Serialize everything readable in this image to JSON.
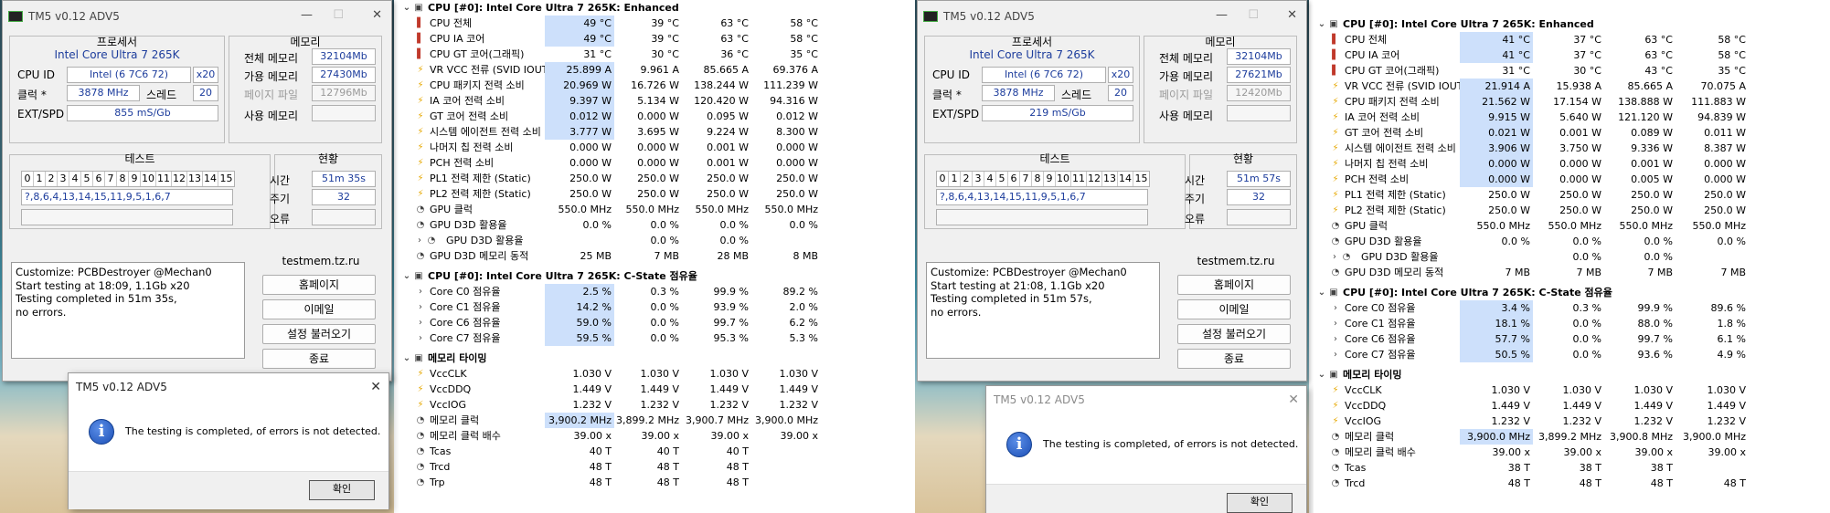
{
  "left": {
    "tm5": {
      "title": "TM5 v0.12 ADV5",
      "proc_label": "프로세서",
      "proc_name": "Intel Core Ultra 7 265K",
      "cpuid_label": "CPU ID",
      "cpuid_value": "Intel  (6 7C6 72)",
      "cpuid_x": "x20",
      "clock_label": "클럭 *",
      "clock_value": "3878 MHz",
      "thread_label": "스레드",
      "thread_value": "20",
      "extspd_label": "EXT/SPD",
      "extspd_value": "855 mS/Gb",
      "mem_label": "메모리",
      "total_mem_label": "전체 메모리",
      "total_mem_value": "32104Mb",
      "avail_mem_label": "가용 메모리",
      "avail_mem_value": "27430Mb",
      "page_file_label": "페이지 파일",
      "page_file_value": "12796Mb",
      "used_mem_label": "사용 메모리",
      "test_label": "테스트",
      "test_nums": [
        "0",
        "1",
        "2",
        "3",
        "4",
        "5",
        "6",
        "7",
        "8",
        "9",
        "10",
        "11",
        "12",
        "13",
        "14",
        "15"
      ],
      "test_seq": "?,8,6,4,13,14,15,11,9,5,1,6,7",
      "status_label": "현황",
      "time_label": "시간",
      "time_value": "51m 35s",
      "cycle_label": "주기",
      "cycle_value": "32",
      "error_label": "오류",
      "log": "Customize: PCBDestroyer @Mechan0\nStart testing at 18:09, 1.1Gb x20\nTesting completed in 51m 35s,\nno errors.",
      "site": "testmem.tz.ru",
      "btn_home": "홈페이지",
      "btn_email": "이메일",
      "btn_load": "설정 불러오기",
      "btn_exit": "종료"
    },
    "dialog": {
      "title": "TM5 v0.12 ADV5",
      "message": "The testing is completed, of errors is not detected.",
      "ok": "확인"
    },
    "hw": {
      "sections": [
        {
          "title": "CPU [#0]: Intel Core Ultra 7 265K: Enhanced",
          "rows": [
            {
              "icon": "therm",
              "label": "CPU 전체",
              "v": [
                "49 °C",
                "39 °C",
                "63 °C",
                "58 °C"
              ],
              "hl": true
            },
            {
              "icon": "therm",
              "label": "CPU IA 코어",
              "v": [
                "49 °C",
                "39 °C",
                "63 °C",
                "58 °C"
              ],
              "hl": true
            },
            {
              "icon": "therm",
              "label": "CPU GT 코어(그래픽)",
              "v": [
                "31 °C",
                "30 °C",
                "36 °C",
                "35 °C"
              ]
            },
            {
              "icon": "bolt",
              "label": "VR VCC 전류 (SVID IOUT)",
              "v": [
                "25.899 A",
                "9.961 A",
                "85.665 A",
                "69.376 A"
              ],
              "hl": true
            },
            {
              "icon": "bolt",
              "label": "CPU 패키지 전력 소비",
              "v": [
                "20.969 W",
                "16.726 W",
                "138.244 W",
                "111.239 W"
              ],
              "hl": true
            },
            {
              "icon": "bolt",
              "label": "IA 코어 전력 소비",
              "v": [
                "9.397 W",
                "5.134 W",
                "120.420 W",
                "94.316 W"
              ],
              "hl": true
            },
            {
              "icon": "bolt",
              "label": "GT 코어 전력 소비",
              "v": [
                "0.012 W",
                "0.000 W",
                "0.095 W",
                "0.012 W"
              ],
              "hl": true
            },
            {
              "icon": "bolt",
              "label": "시스템 에이전트 전력 소비",
              "v": [
                "3.777 W",
                "3.695 W",
                "9.224 W",
                "8.300 W"
              ],
              "hl": true
            },
            {
              "icon": "bolt",
              "label": "나머지 칩 전력 소비",
              "v": [
                "0.000 W",
                "0.000 W",
                "0.001 W",
                "0.000 W"
              ]
            },
            {
              "icon": "bolt",
              "label": "PCH 전력 소비",
              "v": [
                "0.000 W",
                "0.000 W",
                "0.001 W",
                "0.000 W"
              ]
            },
            {
              "icon": "bolt",
              "label": "PL1 전력 제한 (Static)",
              "v": [
                "250.0 W",
                "250.0 W",
                "250.0 W",
                "250.0 W"
              ]
            },
            {
              "icon": "bolt",
              "label": "PL2 전력 제한 (Static)",
              "v": [
                "250.0 W",
                "250.0 W",
                "250.0 W",
                "250.0 W"
              ]
            },
            {
              "icon": "clock",
              "label": "GPU 클럭",
              "v": [
                "550.0 MHz",
                "550.0 MHz",
                "550.0 MHz",
                "550.0 MHz"
              ]
            },
            {
              "icon": "clock",
              "label": "GPU D3D 활용율",
              "v": [
                "0.0 %",
                "0.0 %",
                "0.0 %",
                "0.0 %"
              ]
            },
            {
              "icon": "chev",
              "label": "GPU D3D 활용율",
              "v": [
                "",
                "0.0 %",
                "0.0 %",
                ""
              ],
              "indent": true
            },
            {
              "icon": "clock",
              "label": "GPU D3D 메모리 동적",
              "v": [
                "25 MB",
                "7 MB",
                "28 MB",
                "8 MB"
              ]
            }
          ]
        },
        {
          "title": "CPU [#0]: Intel Core Ultra 7 265K: C-State 점유율",
          "rows": [
            {
              "icon": "chev",
              "label": "Core C0 점유율",
              "v": [
                "2.5 %",
                "0.3 %",
                "99.9 %",
                "89.2 %"
              ],
              "hl": true
            },
            {
              "icon": "chev",
              "label": "Core C1 점유율",
              "v": [
                "14.2 %",
                "0.0 %",
                "93.9 %",
                "2.0 %"
              ],
              "hl": true
            },
            {
              "icon": "chev",
              "label": "Core C6 점유율",
              "v": [
                "59.0 %",
                "0.0 %",
                "99.7 %",
                "6.2 %"
              ],
              "hl": true
            },
            {
              "icon": "chev",
              "label": "Core C7 점유율",
              "v": [
                "59.5 %",
                "0.0 %",
                "95.3 %",
                "5.3 %"
              ],
              "hl": true
            }
          ]
        },
        {
          "title": "메모리 타이밍",
          "rows": [
            {
              "icon": "bolt",
              "label": "VccCLK",
              "v": [
                "1.030 V",
                "1.030 V",
                "1.030 V",
                "1.030 V"
              ]
            },
            {
              "icon": "bolt",
              "label": "VccDDQ",
              "v": [
                "1.449 V",
                "1.449 V",
                "1.449 V",
                "1.449 V"
              ]
            },
            {
              "icon": "bolt",
              "label": "VccIOG",
              "v": [
                "1.232 V",
                "1.232 V",
                "1.232 V",
                "1.232 V"
              ]
            },
            {
              "icon": "clock",
              "label": "메모리 클럭",
              "v": [
                "3,900.2 MHz",
                "3,899.2 MHz",
                "3,900.7 MHz",
                "3,900.0 MHz"
              ],
              "hl": true
            },
            {
              "icon": "clock",
              "label": "메모리 클럭 배수",
              "v": [
                "39.00 x",
                "39.00 x",
                "39.00 x",
                "39.00 x"
              ]
            },
            {
              "icon": "clock",
              "label": "Tcas",
              "v": [
                "40 T",
                "40 T",
                "40 T",
                ""
              ]
            },
            {
              "icon": "clock",
              "label": "Trcd",
              "v": [
                "48 T",
                "48 T",
                "48 T",
                ""
              ]
            },
            {
              "icon": "clock",
              "label": "Trp",
              "v": [
                "48 T",
                "48 T",
                "48 T",
                ""
              ]
            }
          ]
        }
      ]
    }
  },
  "right": {
    "tm5": {
      "title": "TM5 v0.12 ADV5",
      "proc_label": "프로세서",
      "proc_name": "Intel Core Ultra 7 265K",
      "cpuid_label": "CPU ID",
      "cpuid_value": "Intel  (6 7C6 72)",
      "cpuid_x": "x20",
      "clock_label": "클럭 *",
      "clock_value": "3878 MHz",
      "thread_label": "스레드",
      "thread_value": "20",
      "extspd_label": "EXT/SPD",
      "extspd_value": "219 mS/Gb",
      "mem_label": "메모리",
      "total_mem_label": "전체 메모리",
      "total_mem_value": "32104Mb",
      "avail_mem_label": "가용 메모리",
      "avail_mem_value": "27621Mb",
      "page_file_label": "페이지 파일",
      "page_file_value": "12420Mb",
      "used_mem_label": "사용 메모리",
      "test_label": "테스트",
      "test_nums": [
        "0",
        "1",
        "2",
        "3",
        "4",
        "5",
        "6",
        "7",
        "8",
        "9",
        "10",
        "11",
        "12",
        "13",
        "14",
        "15"
      ],
      "test_seq": "?,8,6,4,13,14,15,11,9,5,1,6,7",
      "status_label": "현황",
      "time_label": "시간",
      "time_value": "51m 57s",
      "cycle_label": "주기",
      "cycle_value": "32",
      "error_label": "오류",
      "log": "Customize: PCBDestroyer @Mechan0\nStart testing at 21:08, 1.1Gb x20\nTesting completed in 51m 57s,\nno errors.",
      "site": "testmem.tz.ru",
      "btn_home": "홈페이지",
      "btn_email": "이메일",
      "btn_load": "설정 불러오기",
      "btn_exit": "종료"
    },
    "dialog": {
      "title": "TM5 v0.12 ADV5",
      "message": "The testing is completed, of errors is not detected.",
      "ok": "확인"
    },
    "hw": {
      "sections": [
        {
          "title": "CPU [#0]: Intel Core Ultra 7 265K: Enhanced",
          "rows": [
            {
              "icon": "therm",
              "label": "CPU 전체",
              "v": [
                "41 °C",
                "37 °C",
                "63 °C",
                "58 °C"
              ],
              "hl": true
            },
            {
              "icon": "therm",
              "label": "CPU IA 코어",
              "v": [
                "41 °C",
                "37 °C",
                "63 °C",
                "58 °C"
              ],
              "hl": true
            },
            {
              "icon": "therm",
              "label": "CPU GT 코어(그래픽)",
              "v": [
                "31 °C",
                "30 °C",
                "43 °C",
                "35 °C"
              ]
            },
            {
              "icon": "bolt",
              "label": "VR VCC 전류 (SVID IOUT)",
              "v": [
                "21.914 A",
                "15.938 A",
                "85.665 A",
                "70.075 A"
              ],
              "hl": true
            },
            {
              "icon": "bolt",
              "label": "CPU 패키지 전력 소비",
              "v": [
                "21.562 W",
                "17.154 W",
                "138.888 W",
                "111.883 W"
              ],
              "hl": true
            },
            {
              "icon": "bolt",
              "label": "IA 코어 전력 소비",
              "v": [
                "9.915 W",
                "5.640 W",
                "121.120 W",
                "94.839 W"
              ],
              "hl": true
            },
            {
              "icon": "bolt",
              "label": "GT 코어 전력 소비",
              "v": [
                "0.021 W",
                "0.001 W",
                "0.089 W",
                "0.011 W"
              ],
              "hl": true
            },
            {
              "icon": "bolt",
              "label": "시스템 에이전트 전력 소비",
              "v": [
                "3.906 W",
                "3.750 W",
                "9.336 W",
                "8.387 W"
              ],
              "hl": true
            },
            {
              "icon": "bolt",
              "label": "나머지 칩 전력 소비",
              "v": [
                "0.000 W",
                "0.000 W",
                "0.001 W",
                "0.000 W"
              ],
              "hl": true
            },
            {
              "icon": "bolt",
              "label": "PCH 전력 소비",
              "v": [
                "0.000 W",
                "0.000 W",
                "0.005 W",
                "0.000 W"
              ],
              "hl": true
            },
            {
              "icon": "bolt",
              "label": "PL1 전력 제한 (Static)",
              "v": [
                "250.0 W",
                "250.0 W",
                "250.0 W",
                "250.0 W"
              ]
            },
            {
              "icon": "bolt",
              "label": "PL2 전력 제한 (Static)",
              "v": [
                "250.0 W",
                "250.0 W",
                "250.0 W",
                "250.0 W"
              ]
            },
            {
              "icon": "clock",
              "label": "GPU 클럭",
              "v": [
                "550.0 MHz",
                "550.0 MHz",
                "550.0 MHz",
                "550.0 MHz"
              ]
            },
            {
              "icon": "clock",
              "label": "GPU D3D 활용율",
              "v": [
                "0.0 %",
                "0.0 %",
                "0.0 %",
                "0.0 %"
              ]
            },
            {
              "icon": "chev",
              "label": "GPU D3D 활용율",
              "v": [
                "",
                "0.0 %",
                "0.0 %",
                ""
              ],
              "indent": true
            },
            {
              "icon": "clock",
              "label": "GPU D3D 메모리 동적",
              "v": [
                "7 MB",
                "7 MB",
                "7 MB",
                "7 MB"
              ]
            }
          ]
        },
        {
          "title": "CPU [#0]: Intel Core Ultra 7 265K: C-State 점유율",
          "rows": [
            {
              "icon": "chev",
              "label": "Core C0 점유율",
              "v": [
                "3.4 %",
                "0.3 %",
                "99.9 %",
                "89.6 %"
              ],
              "hl": true
            },
            {
              "icon": "chev",
              "label": "Core C1 점유율",
              "v": [
                "18.1 %",
                "0.0 %",
                "88.0 %",
                "1.8 %"
              ],
              "hl": true
            },
            {
              "icon": "chev",
              "label": "Core C6 점유율",
              "v": [
                "57.7 %",
                "0.0 %",
                "99.7 %",
                "6.1 %"
              ],
              "hl": true
            },
            {
              "icon": "chev",
              "label": "Core C7 점유율",
              "v": [
                "50.5 %",
                "0.0 %",
                "93.6 %",
                "4.9 %"
              ],
              "hl": true
            }
          ]
        },
        {
          "title": "메모리 타이밍",
          "rows": [
            {
              "icon": "bolt",
              "label": "VccCLK",
              "v": [
                "1.030 V",
                "1.030 V",
                "1.030 V",
                "1.030 V"
              ]
            },
            {
              "icon": "bolt",
              "label": "VccDDQ",
              "v": [
                "1.449 V",
                "1.449 V",
                "1.449 V",
                "1.449 V"
              ]
            },
            {
              "icon": "bolt",
              "label": "VccIOG",
              "v": [
                "1.232 V",
                "1.232 V",
                "1.232 V",
                "1.232 V"
              ]
            },
            {
              "icon": "clock",
              "label": "메모리 클럭",
              "v": [
                "3,900.0 MHz",
                "3,899.2 MHz",
                "3,900.8 MHz",
                "3,900.0 MHz"
              ],
              "hl": true
            },
            {
              "icon": "clock",
              "label": "메모리 클럭 배수",
              "v": [
                "39.00 x",
                "39.00 x",
                "39.00 x",
                "39.00 x"
              ]
            },
            {
              "icon": "clock",
              "label": "Tcas",
              "v": [
                "38 T",
                "38 T",
                "38 T",
                ""
              ]
            },
            {
              "icon": "clock",
              "label": "Trcd",
              "v": [
                "48 T",
                "48 T",
                "48 T",
                "48 T"
              ]
            }
          ]
        }
      ]
    }
  }
}
